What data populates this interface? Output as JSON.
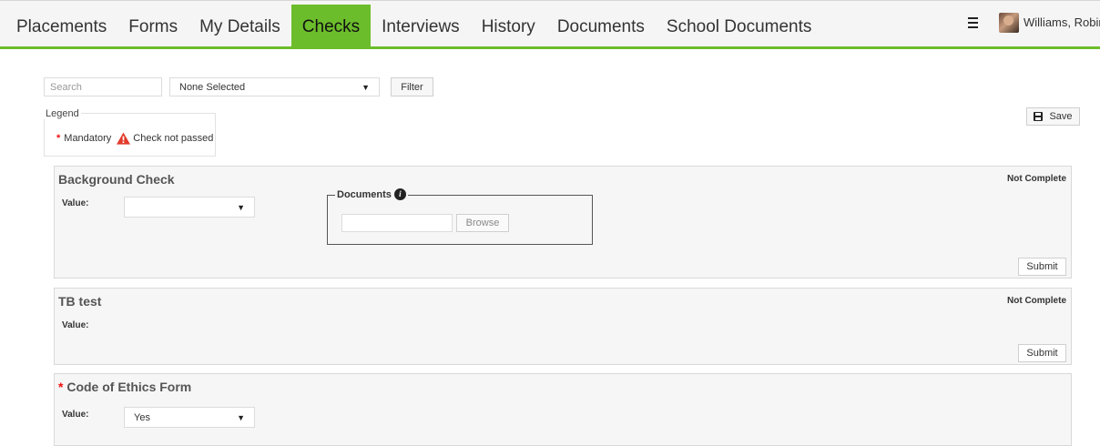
{
  "nav": {
    "items": [
      "Placements",
      "Forms",
      "My Details",
      "Checks",
      "Interviews",
      "History",
      "Documents",
      "School Documents"
    ],
    "active": "Checks",
    "accent": "#6cbd2b"
  },
  "user": {
    "name": "Williams, Robin"
  },
  "filters": {
    "search_placeholder": "Search",
    "select_value": "None Selected",
    "filter_label": "Filter"
  },
  "legend": {
    "title": "Legend",
    "mandatory": "Mandatory",
    "check_not_passed": "Check not passed"
  },
  "save_label": "Save",
  "checks": [
    {
      "title": "Background Check",
      "status": "Not Complete",
      "value_label": "Value:",
      "value": "",
      "documents_label": "Documents",
      "browse_label": "Browse",
      "submit_label": "Submit"
    },
    {
      "title": "TB test",
      "status": "Not Complete",
      "value_label": "Value:",
      "submit_label": "Submit"
    },
    {
      "title": "Code of Ethics Form",
      "mandatory": true,
      "value_label": "Value:",
      "value": "Yes"
    }
  ]
}
